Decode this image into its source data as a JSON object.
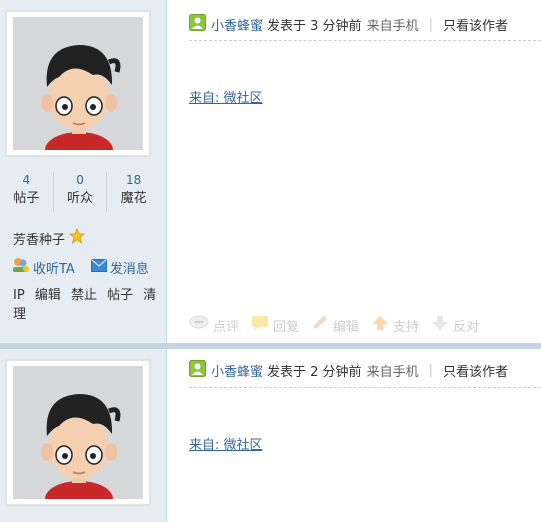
{
  "posts": [
    {
      "author": "小香蜂蜜",
      "posted": "发表于 3 分钟前",
      "source": "来自手机",
      "separator": "|",
      "only_author": "只看该作者",
      "from_label": "来自: 微社区",
      "stats": [
        {
          "num": "4",
          "label": "帖子"
        },
        {
          "num": "0",
          "label": "听众"
        },
        {
          "num": "18",
          "label": "魔花"
        }
      ],
      "rank": "芳香种子",
      "follow": "收听TA",
      "message": "发消息",
      "admin": [
        "IP",
        "编辑",
        "禁止",
        "帖子",
        "清理"
      ],
      "ops": [
        "点评",
        "回复",
        "编辑",
        "支持",
        "反对"
      ]
    },
    {
      "author": "小香蜂蜜",
      "posted": "发表于 2 分钟前",
      "source": "来自手机",
      "separator": "|",
      "only_author": "只看该作者",
      "from_label": "来自: 微社区"
    }
  ]
}
